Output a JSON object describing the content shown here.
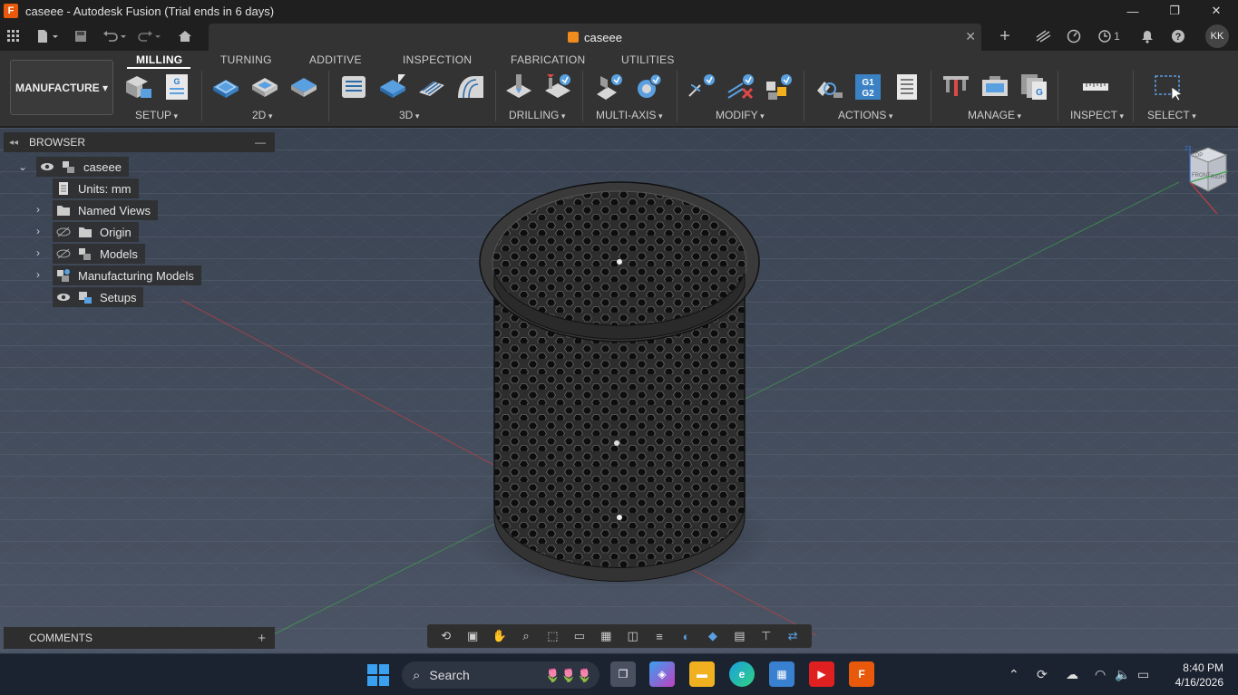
{
  "window": {
    "app_logo": "F",
    "title": "caseee - Autodesk Fusion (Trial ends in 6 days)",
    "minimize": "—",
    "maximize": "❐",
    "close": "✕"
  },
  "quickaccess": {
    "doc_tab": "caseee",
    "tab_close": "✕",
    "add_tab": "+",
    "jobs_count": "1",
    "avatar": "KK"
  },
  "toolbar": {
    "workspace": "MANUFACTURE ▾",
    "tabs": [
      "MILLING",
      "TURNING",
      "ADDITIVE",
      "INSPECTION",
      "FABRICATION",
      "UTILITIES"
    ],
    "groups": [
      "SETUP",
      "2D",
      "3D",
      "DRILLING",
      "MULTI-AXIS",
      "MODIFY",
      "ACTIONS",
      "MANAGE",
      "INSPECT",
      "SELECT"
    ],
    "actions_g1g2": "G1\nG2"
  },
  "browser": {
    "title": "BROWSER",
    "collapse": "—",
    "items": [
      {
        "label": "caseee"
      },
      {
        "label": "Units: mm"
      },
      {
        "label": "Named Views"
      },
      {
        "label": "Origin"
      },
      {
        "label": "Models"
      },
      {
        "label": "Manufacturing Models"
      },
      {
        "label": "Setups"
      }
    ]
  },
  "comments": {
    "title": "COMMENTS",
    "add": "+"
  },
  "viewcube": {
    "top": "TOP",
    "front": "FRONT",
    "right": "RIGHT",
    "axis_z": "Z"
  },
  "taskbar": {
    "search": "Search",
    "fusion_app": "F",
    "time": "8:40 PM",
    "date": "4/16/2026"
  },
  "colors": {
    "accent": "#e8590c",
    "toolbar_bg": "#333333",
    "viewport_top": "#3a4352",
    "viewport_bottom": "#4b5464"
  }
}
